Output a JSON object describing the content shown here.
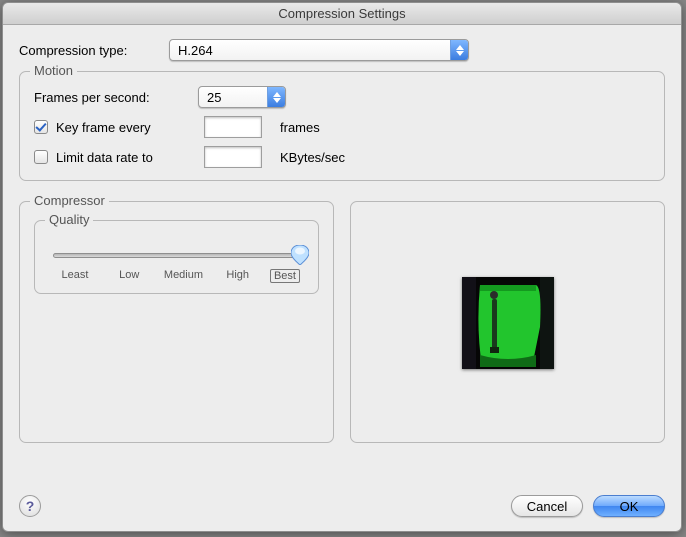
{
  "window": {
    "title": "Compression Settings"
  },
  "compression_type": {
    "label": "Compression type:",
    "value": "H.264"
  },
  "motion": {
    "legend": "Motion",
    "fps_label": "Frames per second:",
    "fps_value": "25",
    "keyframe_checked": true,
    "keyframe_label": "Key frame every",
    "keyframe_value": "",
    "keyframe_unit": "frames",
    "limit_checked": false,
    "limit_label": "Limit data rate to",
    "limit_value": "",
    "limit_unit": "KBytes/sec"
  },
  "compressor": {
    "legend": "Compressor",
    "quality": {
      "legend": "Quality",
      "ticks": [
        "Least",
        "Low",
        "Medium",
        "High",
        "Best"
      ],
      "value_index": 4
    }
  },
  "preview": {
    "description": "green-screen-figure"
  },
  "footer": {
    "help": "?",
    "cancel": "Cancel",
    "ok": "OK"
  }
}
